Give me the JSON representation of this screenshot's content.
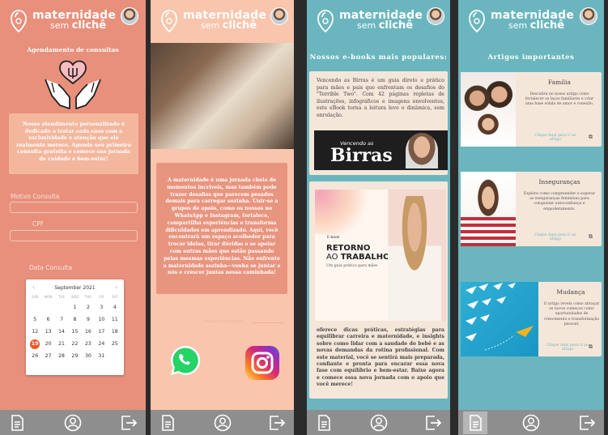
{
  "brand": {
    "line1": "maternidade",
    "line2_prefix": "sem ",
    "line2_main": "clichê"
  },
  "screen1": {
    "title": "Agendamento de consultas",
    "intro": "Nosso atendimento personalizado é dedicado a tratar cada caso com a exclusividade e atenção que ele realmente merece. Agende seu primeiro consulta gratuita e comece sua jornada de cuidado e bem-estar!",
    "motivo_label": "Motivo Consulta",
    "cpf_label": "CPF",
    "data_label": "Data Consulta",
    "calendar": {
      "month": "September 2021",
      "prev": "‹",
      "next": "›",
      "weekdays": [
        "SUN",
        "MON",
        "TUE",
        "WED",
        "THU",
        "FRI",
        "SAT"
      ],
      "days": [
        "",
        "",
        "",
        "1",
        "2",
        "3",
        "4",
        "5",
        "6",
        "7",
        "8",
        "9",
        "10",
        "11",
        "12",
        "13",
        "14",
        "15",
        "16",
        "17",
        "18",
        "19",
        "20",
        "21",
        "22",
        "23",
        "24",
        "25",
        "26",
        "27",
        "28",
        "29",
        "30",
        "31"
      ],
      "selected": "19"
    }
  },
  "screen2": {
    "text": "A maternidade é uma jornada cheia de momentos incríveis, mas também pode trazer desafios que parecem pesados demais para carregar sozinha. Unir-se a grupos de apoio, como os nossos no WhatsApp e Instagram, fortalece, compartilha experiências e transforma dificuldades em aprendizado. Aqui, você encontrará um espaço acolhedor para trocar ideias, tirar dúvidas e se apoiar com outras mães que estão passando pelas mesmas experiências. Não enfrente a maternidade sozinha—venha se juntar a nós e crescer juntas nessa caminhada!",
    "sep_label": "Nossas comunidades"
  },
  "screen3": {
    "title": "Nossos e-books mais populares:",
    "ebook1_text": "Vencendo as Birras é um guia direto e prático para mães e pais que enfrentam os desafios do \"Terrible Two\". Com 42 páginas repletas de ilustrações, infográficos e imagens envolventes, este eBook torna a leitura leve e dinâmica, sem enrolação.",
    "ebook1_cover_small": "Vencendo as",
    "ebook1_cover_big": "Birras",
    "ebook2_kicker": "E-book",
    "ebook2_t1": "RETORNO",
    "ebook2_t2_a": "AO ",
    "ebook2_t2_b": "TRABALHO",
    "ebook2_sub": "Um guia prático para mães",
    "ebook2_text": "oferece dicas práticas, estratégias para equilibrar carreira e maternidade, e insights sobre como lidar com a saudade do bebê e as novas demandas da rotina profissional. Com este material, você se sentirá mais preparada, confiante e pronta para encarar essa nova fase com equilíbrio e bem-estar. Baixe agora e comece essa nova jornada com o apoio que você merece!"
  },
  "screen4": {
    "title": "Artigos importantes",
    "articles": [
      {
        "title": "Família",
        "desc": "Descubra no nosso artigo como fortalecer os laços familiares e criar uma base sólida de amor e conexão.",
        "link": "Clique Aqui para ir ao artigo"
      },
      {
        "title": "Inseguranças",
        "desc": "Explore como compreender e superar as inseguranças femininas para conquistar autoconfiança e empoderamento.",
        "link": "Clique Aqui para ir ao artigo"
      },
      {
        "title": "Mudança",
        "desc": "O artigo revela como abraçar os novos começos como oportunidades de crescimento e transformação pessoal.",
        "link": "Clique Aqui para ir ao artigo"
      }
    ]
  },
  "icons": {
    "nav": [
      "document-icon",
      "user-icon",
      "exit-icon"
    ],
    "ext": "external-link-icon"
  },
  "colors": {
    "coral": "#e8907c",
    "peach": "#f9c5ac",
    "teal": "#6bb6be",
    "cream": "#f5e6da"
  }
}
